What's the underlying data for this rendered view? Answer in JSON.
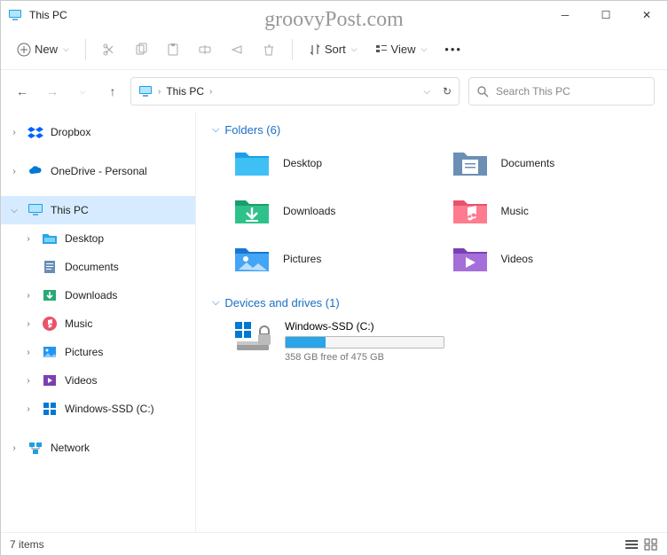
{
  "window": {
    "title": "This PC"
  },
  "watermark": "groovyPost.com",
  "toolbar": {
    "new_label": "New",
    "sort_label": "Sort",
    "view_label": "View"
  },
  "breadcrumb": {
    "root": "This PC"
  },
  "search": {
    "placeholder": "Search This PC"
  },
  "sidebar": {
    "dropbox": "Dropbox",
    "onedrive": "OneDrive - Personal",
    "thispc": "This PC",
    "desktop": "Desktop",
    "documents": "Documents",
    "downloads": "Downloads",
    "music": "Music",
    "pictures": "Pictures",
    "videos": "Videos",
    "drive": "Windows-SSD (C:)",
    "network": "Network"
  },
  "groups": {
    "folders_label": "Folders (6)",
    "drives_label": "Devices and drives (1)"
  },
  "folders": {
    "desktop": "Desktop",
    "documents": "Documents",
    "downloads": "Downloads",
    "music": "Music",
    "pictures": "Pictures",
    "videos": "Videos"
  },
  "drive": {
    "name": "Windows-SSD (C:)",
    "subtext": "358 GB free of 475 GB",
    "used_percent": 25
  },
  "status": {
    "items": "7 items"
  }
}
